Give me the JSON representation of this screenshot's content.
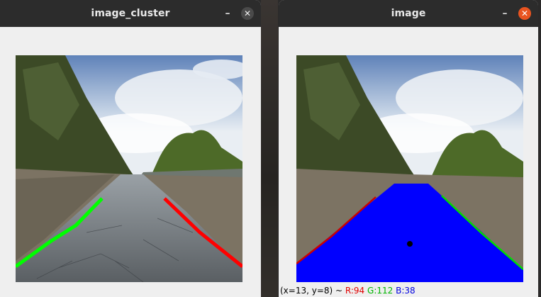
{
  "windows": {
    "left": {
      "title": "image_cluster",
      "minimize_label": "–",
      "close_label": "✕"
    },
    "right": {
      "title": "image",
      "minimize_label": "–",
      "close_label": "✕"
    }
  },
  "status": {
    "coords": "(x=13, y=8) ~",
    "r": "R:94",
    "g": "G:112",
    "b": "B:38"
  },
  "colors": {
    "lane_left_left_window": "#00ff00",
    "lane_right_left_window": "#ff0000",
    "lane_fill": "#0000ff",
    "lane_edge_left": "#cc0000",
    "lane_edge_right": "#00dd00",
    "center_dot": "#000000",
    "close_accent": "#e95420"
  },
  "icons": {
    "minimize": "minimize-icon",
    "close": "close-icon"
  }
}
